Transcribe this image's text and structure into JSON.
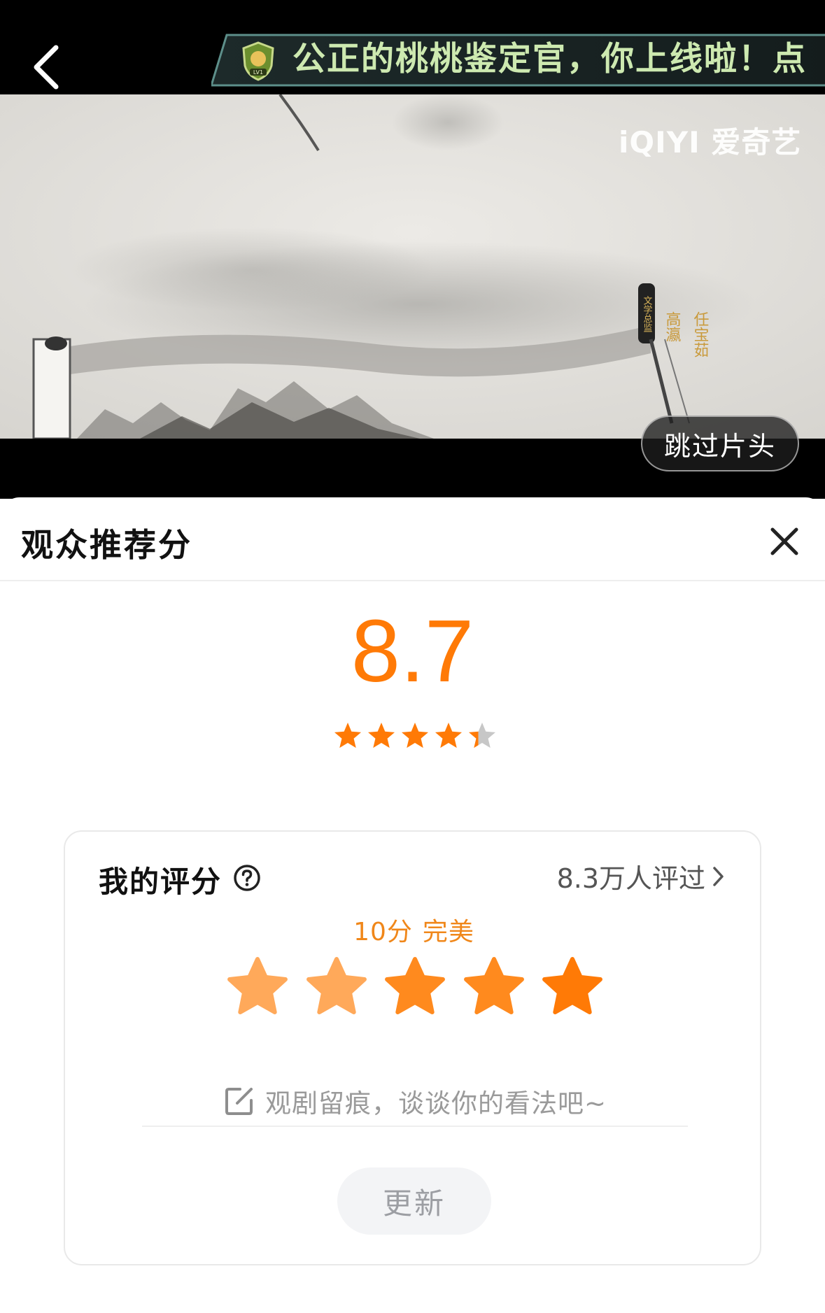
{
  "player": {
    "banner_text": "公正的桃桃鉴定官，你上线啦！点",
    "banner_badge": "LV1",
    "watermark": "iQIYI 爱奇艺",
    "skip_label": "跳过片头",
    "credit_title": "文学总监",
    "credit_names": [
      "高瀛",
      "任宝茹"
    ]
  },
  "sheet": {
    "title": "观众推荐分"
  },
  "rating": {
    "score": "8.7",
    "score_stars_filled": 4.35,
    "score_stars_total": 5,
    "accent_color": "#ff7a06"
  },
  "my_rating": {
    "title": "我的评分",
    "raters": "8.3万人评过",
    "selected_score": "10分",
    "selected_desc": "完美",
    "stars_selected": 5,
    "star_colors": [
      "#ffa95a",
      "#ffa95a",
      "#ff8a1e",
      "#ff8a1e",
      "#ff7a06"
    ],
    "comment_placeholder": "观剧留痕，谈谈你的看法吧~",
    "update_label": "更新"
  },
  "icons": {
    "back": "chevron-left-icon",
    "close": "close-icon",
    "help": "question-circle-icon",
    "more": "chevron-right-icon",
    "edit": "edit-icon",
    "badge": "shield-badge-icon"
  }
}
